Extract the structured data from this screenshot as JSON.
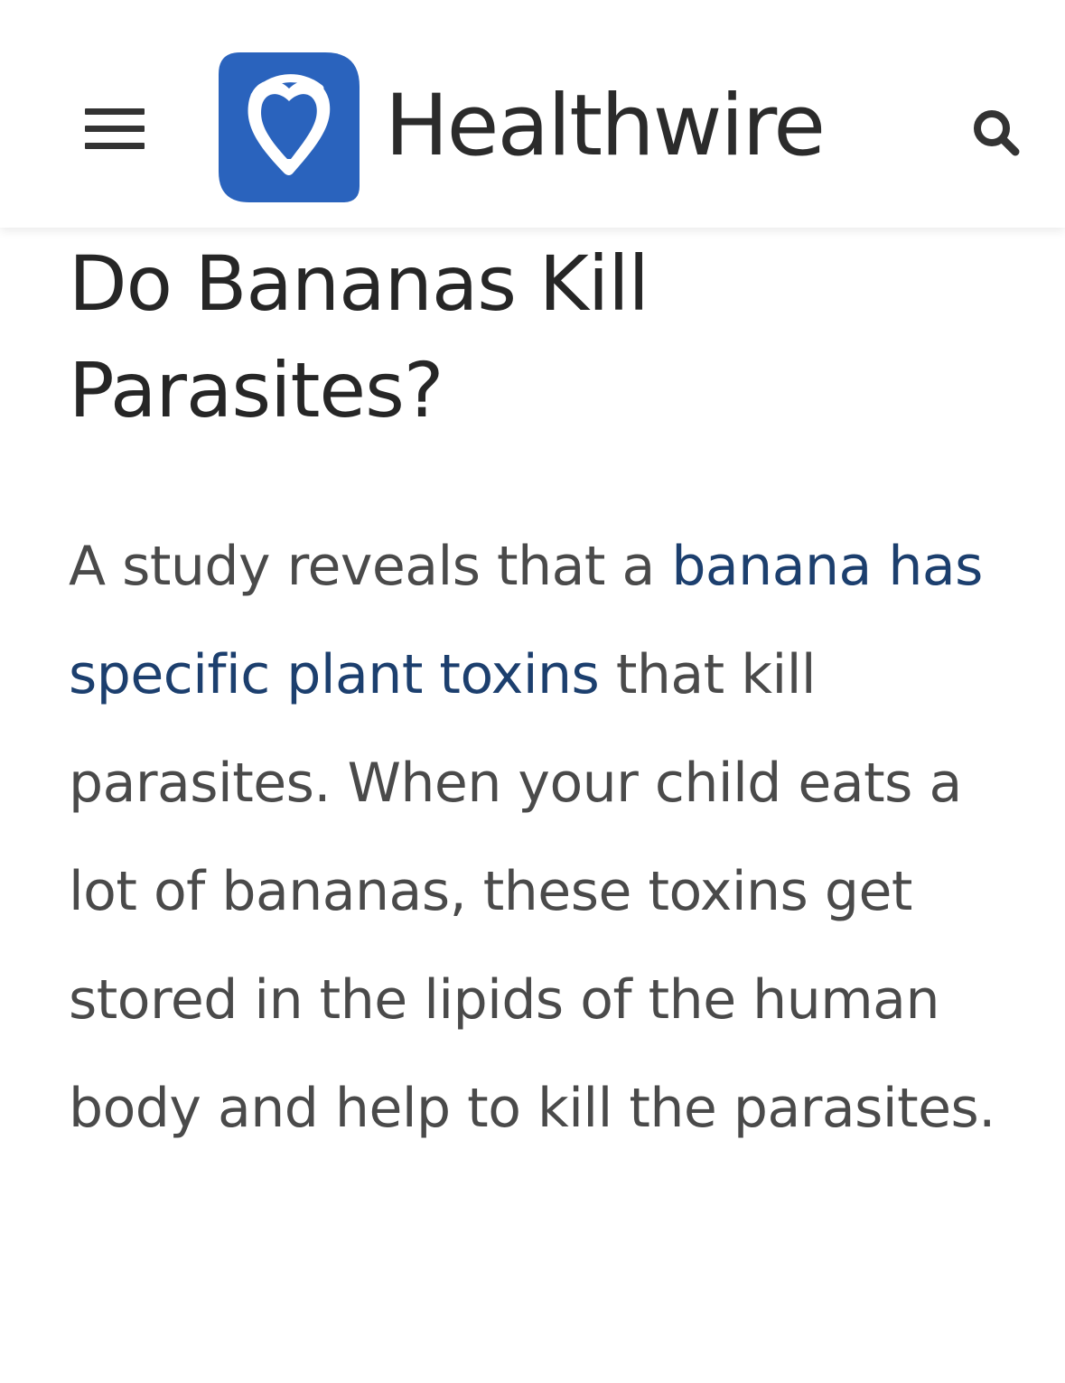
{
  "header": {
    "menu_icon": "hamburger-menu-icon",
    "logo_icon": "healthwire-heart-logo-icon",
    "brand_name": "Healthwire",
    "search_icon": "search-icon",
    "brand_color": "#2a63bd"
  },
  "article": {
    "title": "Do Bananas Kill Parasites?",
    "paragraph": {
      "text_before_link": "A study reveals that a ",
      "link_text": "banana has specific plant toxins",
      "text_after_link": " that kill parasites. When your child eats a lot of bananas, these toxins get stored in the lipids of the human body and help to kill the parasites."
    },
    "link_color": "#1c3f6e",
    "text_color": "#4a4a4a"
  }
}
